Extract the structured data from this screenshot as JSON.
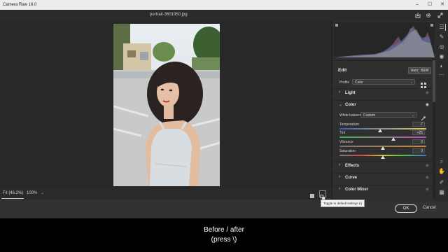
{
  "window": {
    "title": "Camera Raw 16.0",
    "controls": [
      "–",
      "☐",
      "✕"
    ]
  },
  "file": {
    "name": "portrait-3601950.jpg"
  },
  "header_icons": [
    "save-icon",
    "gear-icon",
    "fullscreen-icon"
  ],
  "bottombar": {
    "fit": "Fit (46.2%)",
    "zoom": "100%",
    "caret": "⌄",
    "tooltip": "Toggle to default settings (\\)"
  },
  "tools": [
    "edit-icon",
    "healing-icon",
    "masking-icon",
    "redeye-icon",
    "presets-icon",
    "more-icon",
    "zoom-icon",
    "hand-icon",
    "sampler-icon",
    "grid-icon"
  ],
  "panel": {
    "edit_label": "Edit",
    "auto_label": "Auto",
    "bw_label": "B&W",
    "profile_label": "Profile",
    "profile_value": "Color",
    "sections": {
      "light": "Light",
      "color": "Color",
      "effects": "Effects",
      "curve": "Curve",
      "color_mixer": "Color Mixer"
    },
    "white_balance_label": "White balance",
    "white_balance_value": "Custom",
    "sliders": [
      {
        "label": "Temperature",
        "value": "-7",
        "position": 0.47
      },
      {
        "label": "Tint",
        "value": "+25",
        "position": 0.62
      },
      {
        "label": "Vibrance",
        "value": "0",
        "position": 0.5
      },
      {
        "label": "Saturation",
        "value": "0",
        "position": 0.5
      }
    ]
  },
  "footer": {
    "ok": "OK",
    "cancel": "Cancel"
  },
  "caption": {
    "line1": "Before / after",
    "line2": "(press \\)"
  },
  "colors": {
    "background": "#323232",
    "canvas": "#282828",
    "panel": "#2f2f2f",
    "accent": "#e8e8e8"
  }
}
